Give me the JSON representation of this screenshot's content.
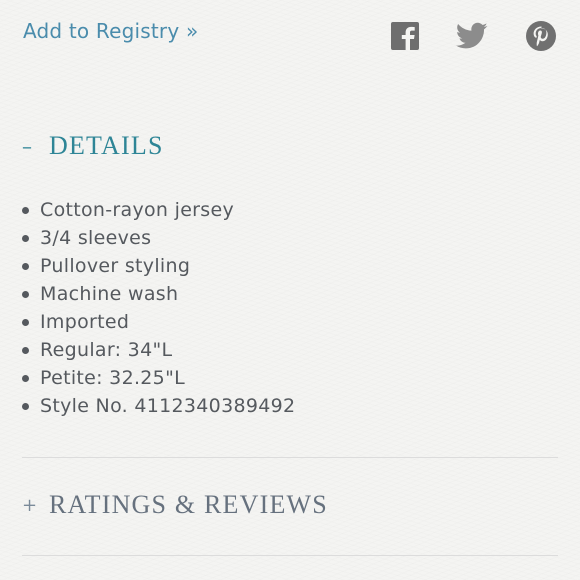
{
  "registry": {
    "label": "Add to Registry »"
  },
  "social": {
    "icons": [
      "facebook-icon",
      "twitter-icon",
      "pinterest-icon"
    ],
    "icon_color": "#707070"
  },
  "details": {
    "toggle_symbol": "–",
    "title": "DETAILS",
    "items": [
      "Cotton-rayon jersey",
      "3/4 sleeves",
      "Pullover styling",
      "Machine wash",
      "Imported",
      "Regular: 34\"L",
      "Petite: 32.25\"L",
      "Style No. 4112340389492"
    ]
  },
  "ratings": {
    "toggle_symbol": "+",
    "title": "RATINGS & REVIEWS"
  },
  "colors": {
    "link": "#4a8cac",
    "accent_teal": "#2e8596",
    "muted_heading": "#66717e",
    "body_text": "#55595e",
    "background": "#f4f4f2"
  }
}
